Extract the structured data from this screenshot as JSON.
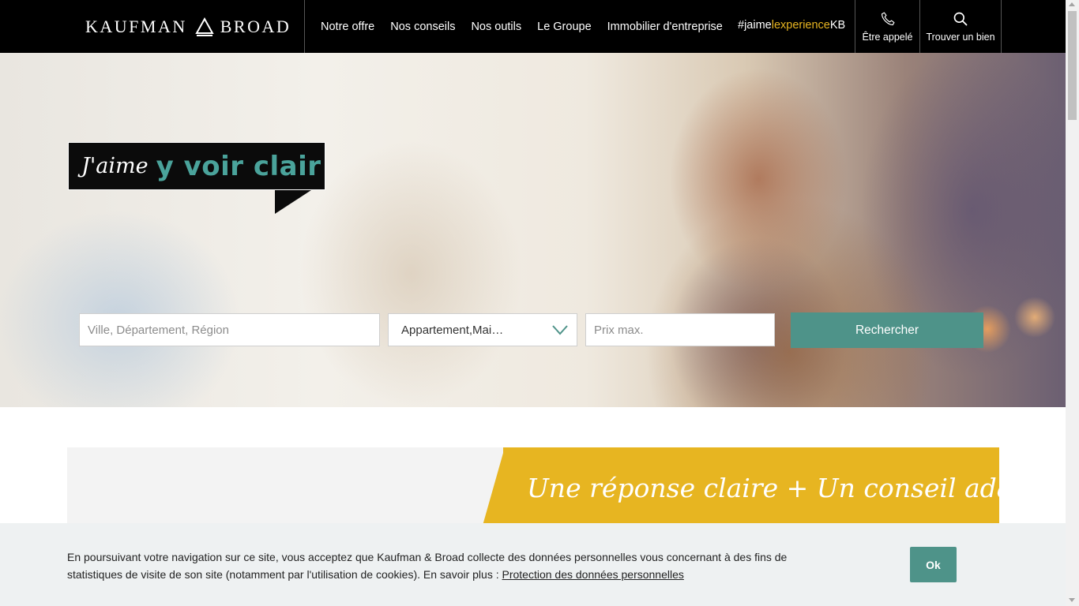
{
  "header": {
    "logo_left": "KAUFMAN",
    "logo_right": "BROAD",
    "nav": [
      "Notre offre",
      "Nos conseils",
      "Nos outils",
      "Le Groupe",
      "Immobilier d'entreprise"
    ],
    "hashtag": {
      "hash": "#jaime",
      "gold": "lexperience",
      "end": "KB"
    },
    "call_label": "Être appelé",
    "find_label": "Trouver un bien",
    "icons": {
      "call": "phone-icon",
      "find": "search-icon"
    }
  },
  "hero": {
    "speech_script": "J'aime",
    "speech_bold": "y voir clair",
    "search": {
      "city_placeholder": "Ville, Département, Région",
      "type_value": "Appartement,Mai…",
      "price_placeholder": "Prix max.",
      "button": "Rechercher"
    }
  },
  "promo": {
    "title": "Une réponse claire + Un conseil adapté"
  },
  "cookie": {
    "text": "En poursuivant votre navigation sur ce site, vous acceptez que Kaufman & Broad collecte des données personnelles vous concernant à des fins de statistiques de visite de son site (notamment par l'utilisation de cookies). En savoir plus : ",
    "link": "Protection des données personnelles",
    "ok": "Ok"
  },
  "colors": {
    "accent_teal": "#4e9389",
    "accent_gold": "#e7b521",
    "header_bg": "#000000"
  }
}
